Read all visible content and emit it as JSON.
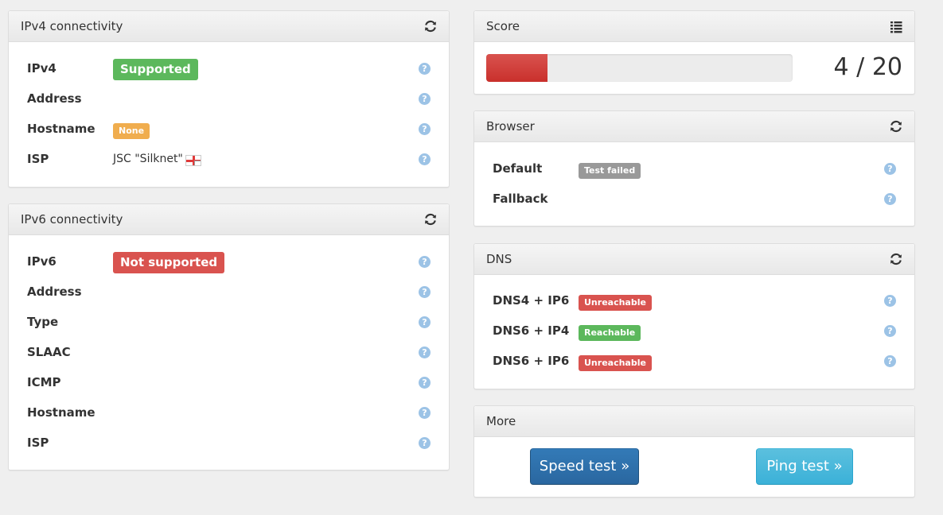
{
  "colors": {
    "success": "#5cb85c",
    "danger": "#d9534f",
    "warning": "#f0ad4e",
    "default": "#999999",
    "primary": "#337ab7",
    "info": "#5bc0de"
  },
  "ipv4": {
    "title": "IPv4 connectivity",
    "rows": [
      {
        "label": "IPv4",
        "badge": "Supported"
      },
      {
        "label": "Address"
      },
      {
        "label": "Hostname",
        "badge": "None"
      },
      {
        "label": "ISP",
        "value": "JSC \"Silknet\"",
        "flag_icon": "georgia-flag-icon"
      }
    ]
  },
  "ipv6": {
    "title": "IPv6 connectivity",
    "rows": [
      {
        "label": "IPv6",
        "badge": "Not supported"
      },
      {
        "label": "Address"
      },
      {
        "label": "Type"
      },
      {
        "label": "SLAAC"
      },
      {
        "label": "ICMP"
      },
      {
        "label": "Hostname"
      },
      {
        "label": "ISP"
      }
    ]
  },
  "score": {
    "title": "Score",
    "value": 4,
    "max": 20,
    "text": "4 / 20"
  },
  "browser": {
    "title": "Browser",
    "rows": [
      {
        "label": "Default",
        "badge": "Test failed"
      },
      {
        "label": "Fallback"
      }
    ]
  },
  "dns": {
    "title": "DNS",
    "rows": [
      {
        "label": "DNS4 + IP6",
        "badge": "Unreachable"
      },
      {
        "label": "DNS6 + IP4",
        "badge": "Reachable"
      },
      {
        "label": "DNS6 + IP6",
        "badge": "Unreachable"
      }
    ]
  },
  "more": {
    "title": "More",
    "speed_button": "Speed test »",
    "ping_button": "Ping test »"
  },
  "help_glyph": "?"
}
